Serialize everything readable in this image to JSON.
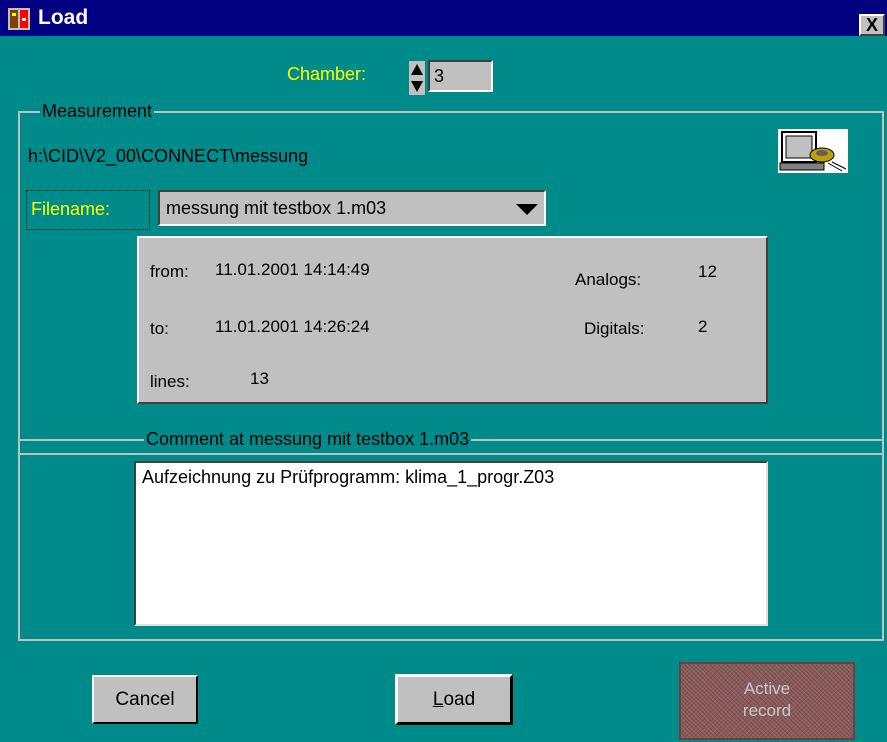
{
  "window": {
    "title": "Load",
    "close_label": "X"
  },
  "chamber": {
    "label": "Chamber:",
    "value": "3"
  },
  "measurement": {
    "group_title": "Measurement",
    "path": "h:\\CID\\V2_00\\CONNECT\\messung",
    "browse_icon": "computer-disk-icon",
    "filename_label": "Filename:",
    "filename_value": "messung mit testbox 1.m03",
    "info": {
      "from_label": "from:",
      "from_value": "11.01.2001  14:14:49",
      "to_label": "to:",
      "to_value": "11.01.2001  14:26:24",
      "lines_label": "lines:",
      "lines_value": "13",
      "analogs_label": "Analogs:",
      "analogs_value": "12",
      "digitals_label": "Digitals:",
      "digitals_value": "2"
    }
  },
  "comment": {
    "group_title": "Comment at messung mit testbox 1.m03",
    "text": "Aufzeichnung zu Prüfprogramm: klima_1_progr.Z03"
  },
  "buttons": {
    "cancel": "Cancel",
    "load_rest": "oad",
    "load_mnemonic": "L",
    "active_record_line1": "Active",
    "active_record_line2": "record"
  },
  "colors": {
    "background": "#008b8b",
    "titlebar": "#000080",
    "highlight_text": "#ffff00",
    "panel": "#c0c0c0"
  }
}
